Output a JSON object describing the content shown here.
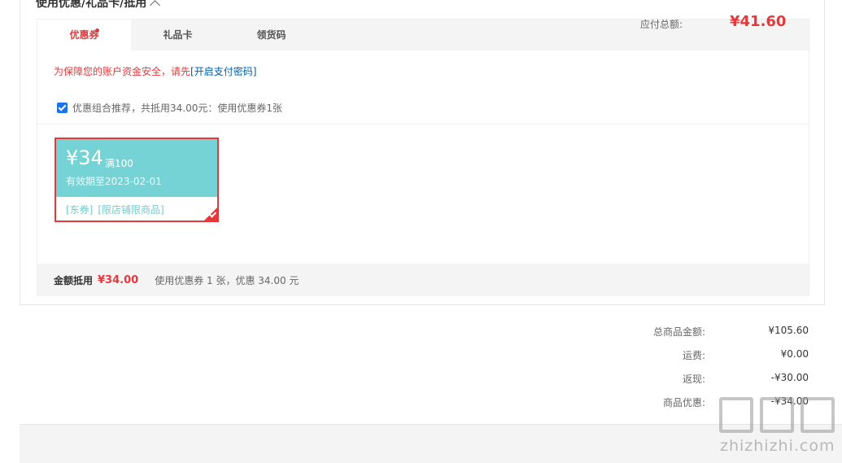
{
  "section": {
    "title": "使用优惠/礼品卡/抵用"
  },
  "tabs": [
    {
      "label": "优惠券",
      "active": true,
      "has_dot": true
    },
    {
      "label": "礼品卡",
      "active": false
    },
    {
      "label": "领货码",
      "active": false
    }
  ],
  "notice": {
    "text": "为保障您的账户资金安全，请先",
    "link": "[开启支付密码]"
  },
  "combo": {
    "checked": true,
    "text": "优惠组合推荐，共抵用34.00元：使用优惠券1张"
  },
  "coupon": {
    "amount": "¥34",
    "condition": "满100",
    "expiry": "有效期至2023-02-01",
    "tags": [
      "[东券]",
      "[限店铺限商品]"
    ],
    "selected": true
  },
  "summary": {
    "label": "金额抵用",
    "amount": "¥34.00",
    "description": "使用优惠券 1 张，优惠 34.00 元"
  },
  "totals": [
    {
      "label": "总商品金额:",
      "value": "¥105.60"
    },
    {
      "label": "运费:",
      "value": "¥0.00"
    },
    {
      "label": "返现:",
      "value": "-¥30.00"
    },
    {
      "label": "商品优惠:",
      "value": "-¥34.00"
    }
  ],
  "payment": {
    "label": "应付总额:",
    "value": "¥41.60"
  },
  "watermark": {
    "text": "zhizhizhi.com"
  },
  "colors": {
    "accent": "#e4393c",
    "coupon": "#76d3d5",
    "link": "#005ea7"
  }
}
